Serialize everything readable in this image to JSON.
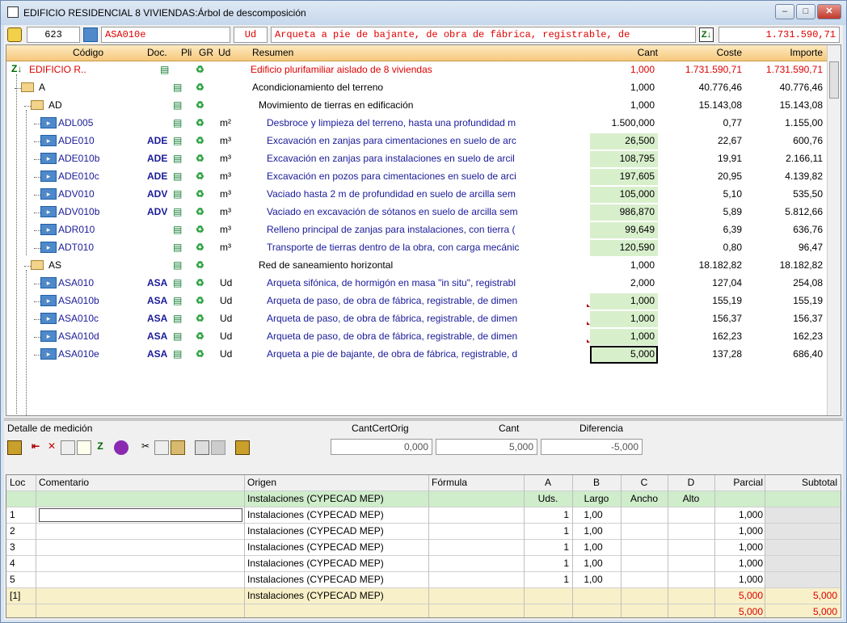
{
  "window": {
    "title": "EDIFICIO RESIDENCIAL 8 VIVIENDAS:Árbol de descomposición"
  },
  "toolbar": {
    "number": "623",
    "code": "ASA010e",
    "unit": "Ud",
    "description": "Arqueta a pie de bajante, de obra de fábrica, registrable, de",
    "total": "1.731.590,71"
  },
  "grid": {
    "headers": {
      "codigo": "Código",
      "doc": "Doc.",
      "pli": "Pli",
      "gr": "GR",
      "ud": "Ud",
      "resumen": "Resumen",
      "cant": "Cant",
      "coste": "Coste",
      "importe": "Importe"
    },
    "rows": [
      {
        "code": "EDIFICIO R..",
        "doc": "",
        "ud": "",
        "resumen": "Edificio plurifamiliar aislado de 8 viviendas",
        "cant": "1,000",
        "coste": "1.731.590,71",
        "importe": "1.731.590,71"
      },
      {
        "code": "A",
        "doc": "",
        "ud": "",
        "resumen": "Acondicionamiento del terreno",
        "cant": "1,000",
        "coste": "40.776,46",
        "importe": "40.776,46"
      },
      {
        "code": "AD",
        "doc": "",
        "ud": "",
        "resumen": "Movimiento de tierras en edificación",
        "cant": "1,000",
        "coste": "15.143,08",
        "importe": "15.143,08"
      },
      {
        "code": "ADL005",
        "doc": "",
        "ud": "m²",
        "resumen": "Desbroce y limpieza del terreno, hasta una profundidad m",
        "cant": "1.500,000",
        "coste": "0,77",
        "importe": "1.155,00"
      },
      {
        "code": "ADE010",
        "doc": "ADE",
        "ud": "m³",
        "resumen": "Excavación en zanjas para cimentaciones en suelo de arc",
        "cant": "26,500",
        "coste": "22,67",
        "importe": "600,76"
      },
      {
        "code": "ADE010b",
        "doc": "ADE",
        "ud": "m³",
        "resumen": "Excavación en zanjas para instalaciones en suelo de arcil",
        "cant": "108,795",
        "coste": "19,91",
        "importe": "2.166,11"
      },
      {
        "code": "ADE010c",
        "doc": "ADE",
        "ud": "m³",
        "resumen": "Excavación en pozos para cimentaciones en suelo de arci",
        "cant": "197,605",
        "coste": "20,95",
        "importe": "4.139,82"
      },
      {
        "code": "ADV010",
        "doc": "ADV",
        "ud": "m³",
        "resumen": "Vaciado hasta 2 m de profundidad en suelo de arcilla sem",
        "cant": "105,000",
        "coste": "5,10",
        "importe": "535,50"
      },
      {
        "code": "ADV010b",
        "doc": "ADV",
        "ud": "m³",
        "resumen": "Vaciado en excavación de sótanos en suelo de arcilla sem",
        "cant": "986,870",
        "coste": "5,89",
        "importe": "5.812,66"
      },
      {
        "code": "ADR010",
        "doc": "",
        "ud": "m³",
        "resumen": "Relleno principal de zanjas para instalaciones, con tierra (",
        "cant": "99,649",
        "coste": "6,39",
        "importe": "636,76"
      },
      {
        "code": "ADT010",
        "doc": "",
        "ud": "m³",
        "resumen": "Transporte de tierras dentro de la obra, con carga mecánic",
        "cant": "120,590",
        "coste": "0,80",
        "importe": "96,47"
      },
      {
        "code": "AS",
        "doc": "",
        "ud": "",
        "resumen": "Red de saneamiento horizontal",
        "cant": "1,000",
        "coste": "18.182,82",
        "importe": "18.182,82"
      },
      {
        "code": "ASA010",
        "doc": "ASA",
        "ud": "Ud",
        "resumen": "Arqueta sifónica, de hormigón en masa \"in situ\", registrabl",
        "cant": "2,000",
        "coste": "127,04",
        "importe": "254,08"
      },
      {
        "code": "ASA010b",
        "doc": "ASA",
        "ud": "Ud",
        "resumen": "Arqueta de paso, de obra de fábrica, registrable, de dimen",
        "cant": "1,000",
        "coste": "155,19",
        "importe": "155,19"
      },
      {
        "code": "ASA010c",
        "doc": "ASA",
        "ud": "Ud",
        "resumen": "Arqueta de paso, de obra de fábrica, registrable, de dimen",
        "cant": "1,000",
        "coste": "156,37",
        "importe": "156,37"
      },
      {
        "code": "ASA010d",
        "doc": "ASA",
        "ud": "Ud",
        "resumen": "Arqueta de paso, de obra de fábrica, registrable, de dimen",
        "cant": "1,000",
        "coste": "162,23",
        "importe": "162,23"
      },
      {
        "code": "ASA010e",
        "doc": "ASA",
        "ud": "Ud",
        "resumen": "Arqueta a pie de bajante, de obra de fábrica, registrable, d",
        "cant": "5,000",
        "coste": "137,28",
        "importe": "686,40"
      }
    ]
  },
  "detail": {
    "label": "Detalle de medición",
    "cantcert_label": "CantCertOrig",
    "cant_label": "Cant",
    "dif_label": "Diferencia",
    "cantcert": "0,000",
    "cant": "5,000",
    "dif": "-5,000",
    "headers": {
      "loc": "Loc",
      "comentario": "Comentario",
      "origen": "Origen",
      "formula": "Fórmula",
      "a": "A",
      "b": "B",
      "c": "C",
      "d": "D",
      "parcial": "Parcial",
      "subtotal": "Subtotal"
    },
    "subheaders": {
      "origen": "Instalaciones (CYPECAD MEP)",
      "a": "Uds.",
      "b": "Largo",
      "c": "Ancho",
      "d": "Alto"
    },
    "rows": [
      {
        "loc": "1",
        "origen": "Instalaciones (CYPECAD MEP)",
        "a": "1",
        "b": "1,00",
        "parcial": "1,000",
        "subtotal": ""
      },
      {
        "loc": "2",
        "origen": "Instalaciones (CYPECAD MEP)",
        "a": "1",
        "b": "1,00",
        "parcial": "1,000",
        "subtotal": ""
      },
      {
        "loc": "3",
        "origen": "Instalaciones (CYPECAD MEP)",
        "a": "1",
        "b": "1,00",
        "parcial": "1,000",
        "subtotal": ""
      },
      {
        "loc": "4",
        "origen": "Instalaciones (CYPECAD MEP)",
        "a": "1",
        "b": "1,00",
        "parcial": "1,000",
        "subtotal": ""
      },
      {
        "loc": "5",
        "origen": "Instalaciones (CYPECAD MEP)",
        "a": "1",
        "b": "1,00",
        "parcial": "1,000",
        "subtotal": ""
      }
    ],
    "sumrow": {
      "loc": "[1]",
      "origen": "Instalaciones (CYPECAD MEP)",
      "parcial": "5,000",
      "subtotal": "5,000"
    },
    "totalrow": {
      "parcial": "5,000",
      "subtotal": "5,000"
    }
  }
}
